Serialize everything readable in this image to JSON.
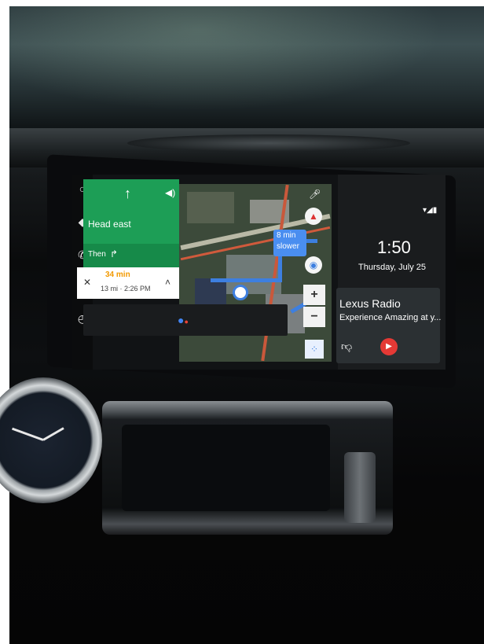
{
  "navigation": {
    "direction": "Head east",
    "then_label": "Then",
    "eta_minutes": "34 min",
    "eta_details": "13 mi · 2:26 PM",
    "traffic_badge_line1": "8 min",
    "traffic_badge_line2": "slower"
  },
  "status": {
    "time": "1:50",
    "date": "Thursday, July 25"
  },
  "media": {
    "title": "Lexus Radio",
    "subtitle": "Experience Amazing at y..."
  },
  "icons": {
    "rail": [
      "home-circle-icon",
      "navigation-diamond-icon",
      "phone-icon",
      "headphones-icon",
      "recent-clock-icon"
    ],
    "controls": [
      "up-arrow-icon",
      "volume-icon",
      "turn-right-icon",
      "close-icon",
      "chevron-up-icon",
      "assistant-dots-icon",
      "mic-icon",
      "compass-icon",
      "recenter-icon",
      "thumbs-down-icon",
      "play-icon",
      "status-signal-icon"
    ]
  },
  "colors": {
    "nav_green": "#1d9e56",
    "eta_orange": "#f29900",
    "route_blue": "#3d7fe0",
    "play_red": "#e53935"
  },
  "zoom": {
    "plus": "+",
    "minus": "−"
  }
}
